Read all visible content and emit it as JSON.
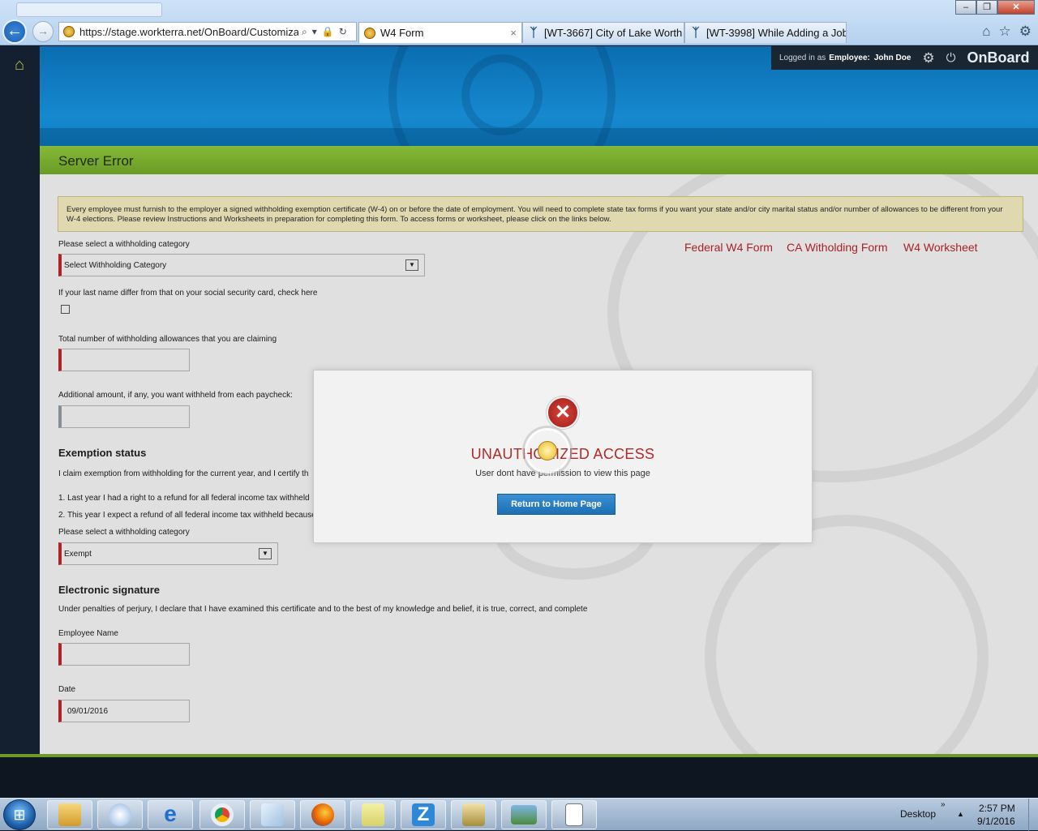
{
  "browser": {
    "url": "https://stage.workterra.net/OnBoard/Customization",
    "tabs": [
      {
        "title": "W4 Form",
        "close": "×"
      },
      {
        "title": "[WT-3667] City of Lake Worth ..."
      },
      {
        "title": "[WT-3998] While Adding a Job ..."
      }
    ]
  },
  "header": {
    "logged_in_label": "Logged in as",
    "role": "Employee:",
    "user_name": "John Doe",
    "brand": "OnBoard"
  },
  "page": {
    "title": "Server Error",
    "info_text": "Every employee must furnish to the employer a signed withholding exemption certificate (W-4) on or before the date of employment. You will need to complete state tax forms if you want your state and/or city marital status and/or number of allowances to be different from your W-4 elections. Please review Instructions and Worksheets in preparation for completing this form. To access forms or worksheet, please click on the links below.",
    "links": [
      "Federal W4 Form",
      "CA Witholding Form",
      "W4 Worksheet"
    ],
    "category_label": "Please select a withholding category",
    "category_value": "Select Withholding Category",
    "lastname_label": "If your last name differ from that on your social security card, check here",
    "allowances_label": "Total number of withholding allowances that you are claiming",
    "additional_label": "Additional amount, if any, you want withheld from each paycheck:",
    "exemption_heading": "Exemption status",
    "exemption_claim": "I claim exemption from withholding for the current year, and I certify th",
    "exemption_1": "1. Last year I had a right to a refund for all federal income tax withheld",
    "exemption_2": "2. This year I expect a refund of all federal income tax withheld because",
    "exemption_category_label": "Please select a withholding category",
    "exemption_category_value": "Exempt",
    "signature_heading": "Electronic signature",
    "signature_text": "Under penalties of perjury, I declare that I have examined this certificate and to the best of my knowledge and belief, it is true, correct, and complete",
    "employee_name_label": "Employee Name",
    "date_label": "Date",
    "date_value": "09/01/2016"
  },
  "modal": {
    "title": "UNAUTHORIZED ACCESS",
    "message": "User dont have permission to view this page",
    "button": "Return to Home Page"
  },
  "taskbar": {
    "desktop_label": "Desktop",
    "time": "2:57 PM",
    "date": "9/1/2016"
  },
  "colors": {
    "error_red": "#c9272b",
    "banner_blue": "#1689cf",
    "title_green": "#7aae30",
    "button_blue": "#2a7fc4"
  }
}
